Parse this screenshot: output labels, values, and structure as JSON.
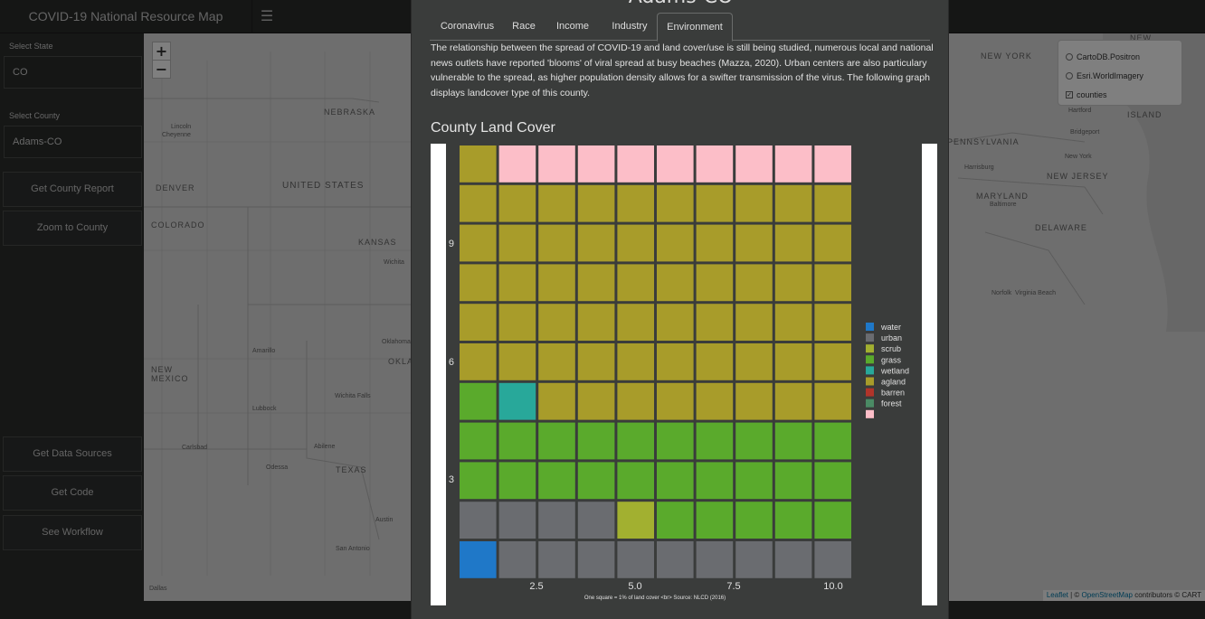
{
  "header": {
    "title": "COVID-19 National Resource Map",
    "menu_icon": "hamburger-icon"
  },
  "sidebar": {
    "state_label": "Select State",
    "state_value": "CO",
    "county_label": "Select County",
    "county_value": "Adams-CO",
    "buttons": {
      "county_report": "Get County Report",
      "zoom_county": "Zoom to County",
      "data_sources": "Get Data Sources",
      "code": "Get Code",
      "workflow": "See Workflow"
    }
  },
  "map": {
    "zoom_in": "+",
    "zoom_out": "−",
    "layers": {
      "base1": "CartoDB.Positron",
      "base2": "Esri.WorldImagery",
      "overlay": "counties"
    },
    "labels": {
      "nebraska": "NEBRASKA",
      "united_states": "UNITED STATES",
      "kansas": "KANSAS",
      "colorado": "COLORADO",
      "new_mexico": "NEW MEXICO",
      "texas": "TEXAS",
      "oklahoma": "OKLA",
      "new_york": "NEW YORK",
      "pennsylvania": "PENNSYLVANIA",
      "new_jersey": "NEW JERSEY",
      "maryland": "MARYLAND",
      "delaware": "DELAWARE",
      "island": "ISLAND",
      "denver": "DENVER",
      "lincoln": "Lincoln",
      "cheyenne": "Cheyenne",
      "wichita": "Wichita",
      "amarillo": "Amarillo",
      "oklahoma_city": "Oklahoma City",
      "wichita_falls": "Wichita Falls",
      "lubbock": "Lubbock",
      "abilene": "Abilene",
      "odessa": "Odessa",
      "carlsbad": "Carlsbad",
      "austin": "Austin",
      "san_antonio": "San Antonio",
      "dallas": "Dallas",
      "harrisburg": "Harrisburg",
      "hartford": "Hartford",
      "bridgeport": "Bridgeport",
      "new_york_city": "New York",
      "baltimore": "Baltimore",
      "norfolk": "Norfolk",
      "virginia_beach": "Virginia Beach",
      "new_top": "NEW"
    },
    "attribution": {
      "leaflet": "Leaflet",
      "sep": " | © ",
      "osm": "OpenStreetMap",
      "rest": " contributors © CART"
    }
  },
  "modal": {
    "title": "Adams-CO",
    "tabs": [
      "Coronavirus",
      "Race",
      "Income",
      "Industry",
      "Environment"
    ],
    "active_tab": "Environment",
    "description": "The relationship between the spread of COVID-19 and land cover/use is still being studied, numerous local and national news outlets have reported 'blooms' of viral spread at busy beaches (Mazza, 2020). Urban centers are also particulary vulnerable to the spread, as higher population density allows for a swifter transmission of the virus. The following graph displays landcover type of this county.",
    "chart_title": "County Land Cover"
  },
  "chart_data": {
    "type": "waffle",
    "title": "County Land Cover",
    "caption": "One square = 1% of land cover <br> Source: NLCD (2016)",
    "grid": {
      "columns": 10,
      "rows": 11
    },
    "x_ticks": [
      "2.5",
      "5.0",
      "7.5",
      "10.0"
    ],
    "y_ticks": [
      "3",
      "6",
      "9"
    ],
    "legend": [
      {
        "name": "water",
        "color": "#1f78c8"
      },
      {
        "name": "urban",
        "color": "#6a6c70"
      },
      {
        "name": "scrub",
        "color": "#a2b030"
      },
      {
        "name": "grass",
        "color": "#5aaa2c"
      },
      {
        "name": "wetland",
        "color": "#28a89a"
      },
      {
        "name": "agland",
        "color": "#a89c2a"
      },
      {
        "name": "barren",
        "color": "#b0342a"
      },
      {
        "name": "forest",
        "color": "#4a8a64"
      },
      {
        "name": "",
        "color": "#fcbec8"
      }
    ],
    "cells_by_row_top_to_bottom": [
      [
        "agland",
        "forest_pink",
        "forest_pink",
        "forest_pink",
        "forest_pink",
        "forest_pink",
        "forest_pink",
        "forest_pink",
        "forest_pink",
        "forest_pink"
      ],
      [
        "agland",
        "agland",
        "agland",
        "agland",
        "agland",
        "agland",
        "agland",
        "agland",
        "agland",
        "agland"
      ],
      [
        "agland",
        "agland",
        "agland",
        "agland",
        "agland",
        "agland",
        "agland",
        "agland",
        "agland",
        "agland"
      ],
      [
        "agland",
        "agland",
        "agland",
        "agland",
        "agland",
        "agland",
        "agland",
        "agland",
        "agland",
        "agland"
      ],
      [
        "agland",
        "agland",
        "agland",
        "agland",
        "agland",
        "agland",
        "agland",
        "agland",
        "agland",
        "agland"
      ],
      [
        "agland",
        "agland",
        "agland",
        "agland",
        "agland",
        "agland",
        "agland",
        "agland",
        "agland",
        "agland"
      ],
      [
        "grass",
        "wetland",
        "agland",
        "agland",
        "agland",
        "agland",
        "agland",
        "agland",
        "agland",
        "agland"
      ],
      [
        "grass",
        "grass",
        "grass",
        "grass",
        "grass",
        "grass",
        "grass",
        "grass",
        "grass",
        "grass"
      ],
      [
        "grass",
        "grass",
        "grass",
        "grass",
        "grass",
        "grass",
        "grass",
        "grass",
        "grass",
        "grass"
      ],
      [
        "urban",
        "urban",
        "urban",
        "urban",
        "scrub",
        "grass",
        "grass",
        "grass",
        "grass",
        "grass"
      ],
      [
        "water",
        "urban",
        "urban",
        "urban",
        "urban",
        "urban",
        "urban",
        "urban",
        "urban",
        "urban"
      ]
    ],
    "cell_colors": {
      "water": "#1f78c8",
      "urban": "#6a6c70",
      "scrub": "#a2b030",
      "grass": "#5aaa2c",
      "wetland": "#28a89a",
      "agland": "#a89c2a",
      "barren": "#b0342a",
      "forest_pink": "#fcbec8"
    }
  }
}
